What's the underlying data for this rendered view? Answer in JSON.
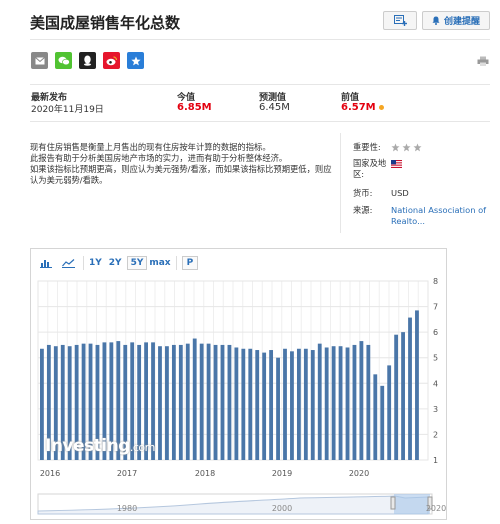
{
  "page": {
    "title": "美国成屋销售年化总数"
  },
  "header": {
    "portfolio_icon": "add-to-portfolio-icon",
    "alert_label": "创建提醒",
    "alert_icon": "bell-icon"
  },
  "share_buttons": [
    {
      "icon": "envelope-icon",
      "color": "#888888"
    },
    {
      "icon": "wechat-icon",
      "color": "#51c332"
    },
    {
      "icon": "qq-icon",
      "color": "#222222"
    },
    {
      "icon": "weibo-icon",
      "color": "#e6162d"
    },
    {
      "icon": "star-icon",
      "color": "#2a7ed8"
    }
  ],
  "stats": {
    "latest_label": "最新发布",
    "latest_value": "2020年11月19日",
    "actual_label": "今值",
    "actual_value": "6.85M",
    "forecast_label": "预测值",
    "forecast_value": "6.45M",
    "previous_label": "前值",
    "previous_value": "6.57M"
  },
  "description": {
    "p1": "现有住房销售是衡量上月售出的现有住房按年计算的数据的指标。",
    "p2": "此报告有助于分析美国房地产市场的实力，进而有助于分析整体经济。",
    "p3": "如果该指标比预期更高，则应认为美元强势/看涨，而如果该指标比预期更低，则应认为美元弱势/看跌。"
  },
  "meta": {
    "importance_label": "重要性:",
    "country_label": "国家及地区:",
    "currency_label": "货币:",
    "currency_value": "USD",
    "source_label": "来源:",
    "source_value": "National Association of Realto..."
  },
  "toolbar": {
    "bar_icon": "bar-chart-icon",
    "area_icon": "area-chart-icon",
    "range1": "1Y",
    "range2": "2Y",
    "range3": "5Y",
    "range4": "max",
    "p_button": "P"
  },
  "watermark": {
    "brand": "Investing",
    "suffix": ".com"
  },
  "chart_data": {
    "type": "bar",
    "series_color": "#4a76a8",
    "ylim": [
      1,
      8
    ],
    "y_ticks": [
      "1",
      "2",
      "3",
      "4",
      "5",
      "6",
      "7",
      "8"
    ],
    "x_tick_labels": [
      "2016",
      "2017",
      "2018",
      "2019",
      "2020"
    ],
    "values": [
      5.35,
      5.5,
      5.45,
      5.5,
      5.45,
      5.5,
      5.55,
      5.55,
      5.5,
      5.6,
      5.6,
      5.65,
      5.5,
      5.6,
      5.5,
      5.6,
      5.6,
      5.45,
      5.45,
      5.5,
      5.5,
      5.55,
      5.75,
      5.55,
      5.55,
      5.5,
      5.5,
      5.5,
      5.4,
      5.35,
      5.35,
      5.3,
      5.2,
      5.3,
      5.0,
      5.35,
      5.25,
      5.35,
      5.35,
      5.3,
      5.55,
      5.4,
      5.45,
      5.45,
      5.4,
      5.5,
      5.65,
      5.5,
      4.35,
      3.9,
      4.7,
      5.9,
      6.0,
      6.57,
      6.85
    ],
    "navigator_labels": [
      "1980",
      "2000",
      "2020"
    ]
  }
}
